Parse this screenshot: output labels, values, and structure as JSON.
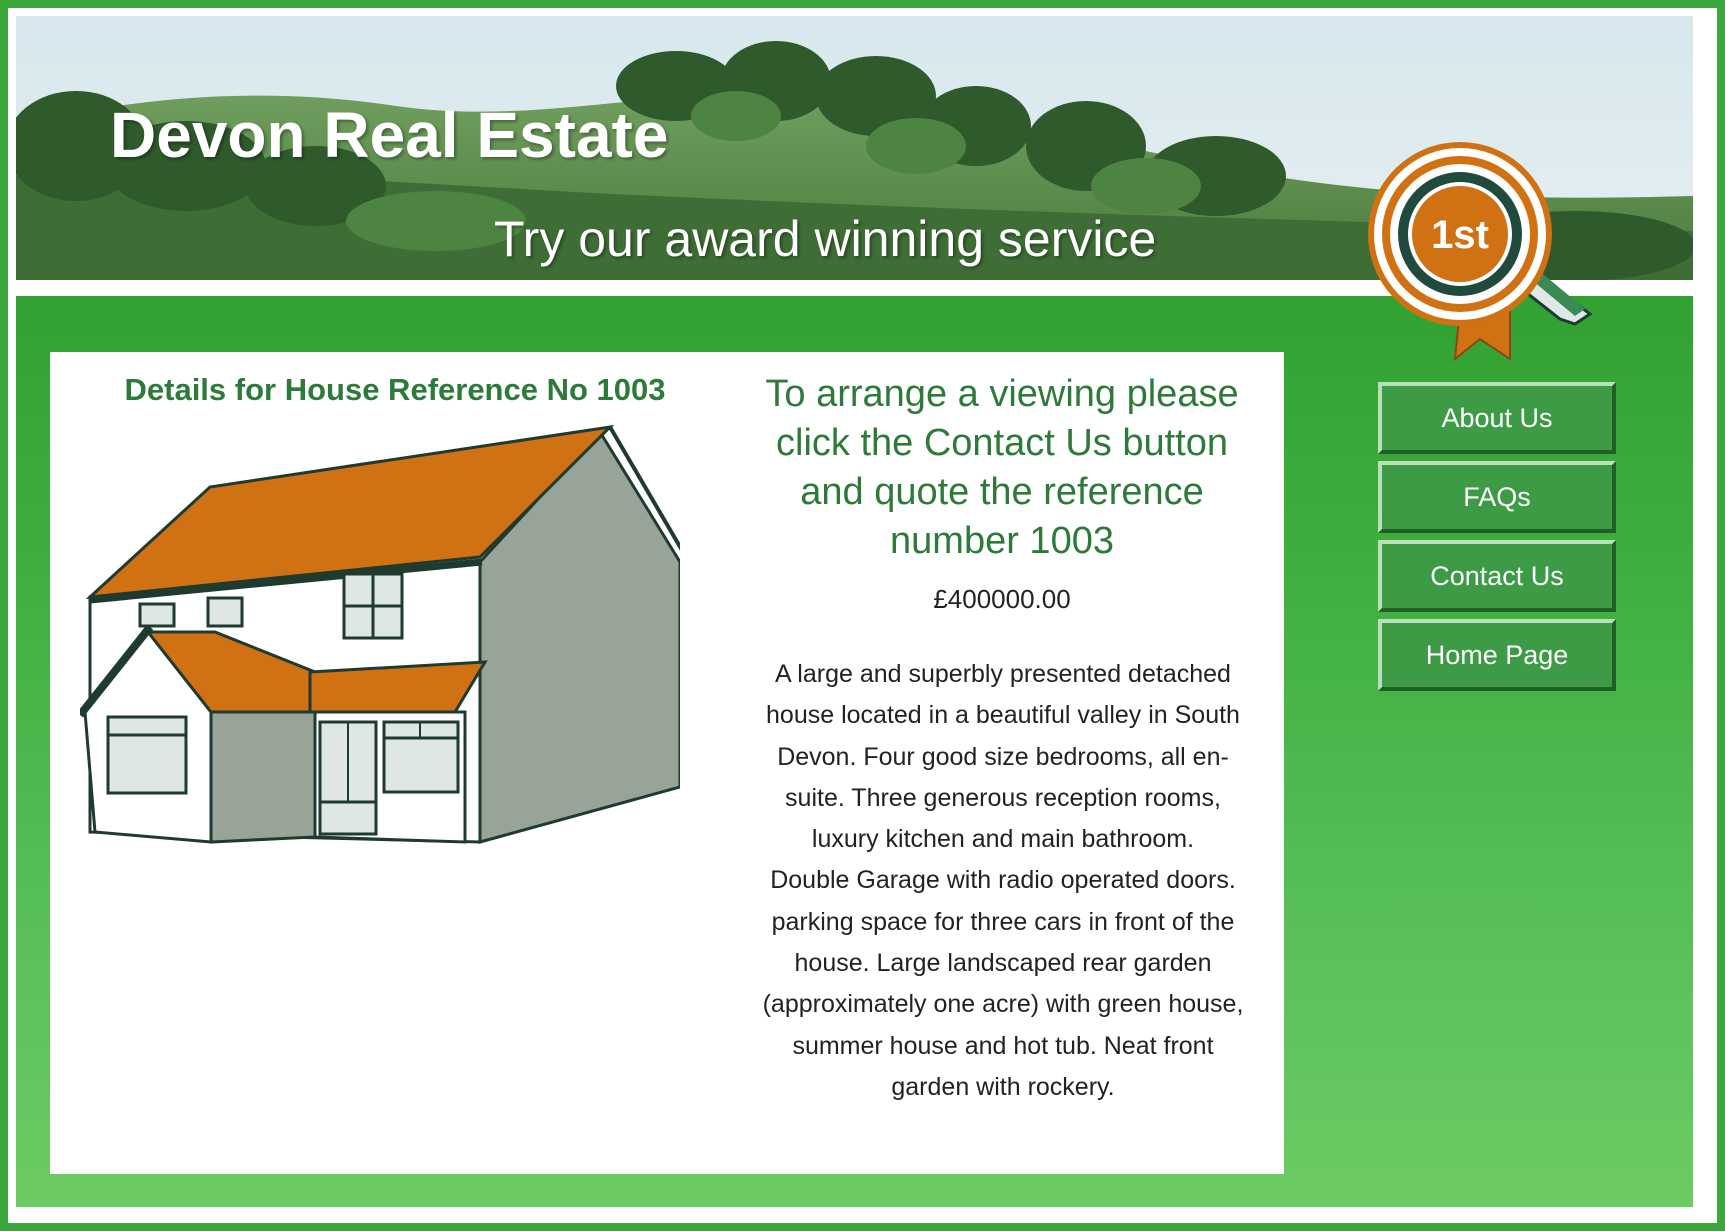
{
  "header": {
    "site_title": "Devon Real Estate",
    "tagline": "Try our award winning service",
    "badge_text": "1st"
  },
  "property": {
    "details_heading": "Details for House Reference No 1003",
    "viewing_message": "To arrange a viewing please click the Contact Us button and quote the reference number 1003",
    "price": "£400000.00",
    "description_1": "A large and superbly presented detached house located in a beautiful valley in South Devon. Four good size bedrooms, all en-suite. Three generous reception rooms, luxury kitchen and main bathroom.",
    "description_2": "Double Garage with radio operated doors. parking space for three cars in front of the house. Large landscaped rear garden (approximately one acre) with green house, summer house and hot tub. Neat front garden with rockery."
  },
  "nav": {
    "items": [
      {
        "label": "About Us"
      },
      {
        "label": "FAQs"
      },
      {
        "label": "Contact Us"
      },
      {
        "label": "Home Page"
      }
    ]
  },
  "colors": {
    "brand_green": "#3aa83a",
    "heading_green": "#2e7a3a",
    "roof_orange": "#d07114",
    "button_green": "#3d9a45"
  },
  "icons": [
    "award-rosette-icon",
    "house-illustration"
  ]
}
